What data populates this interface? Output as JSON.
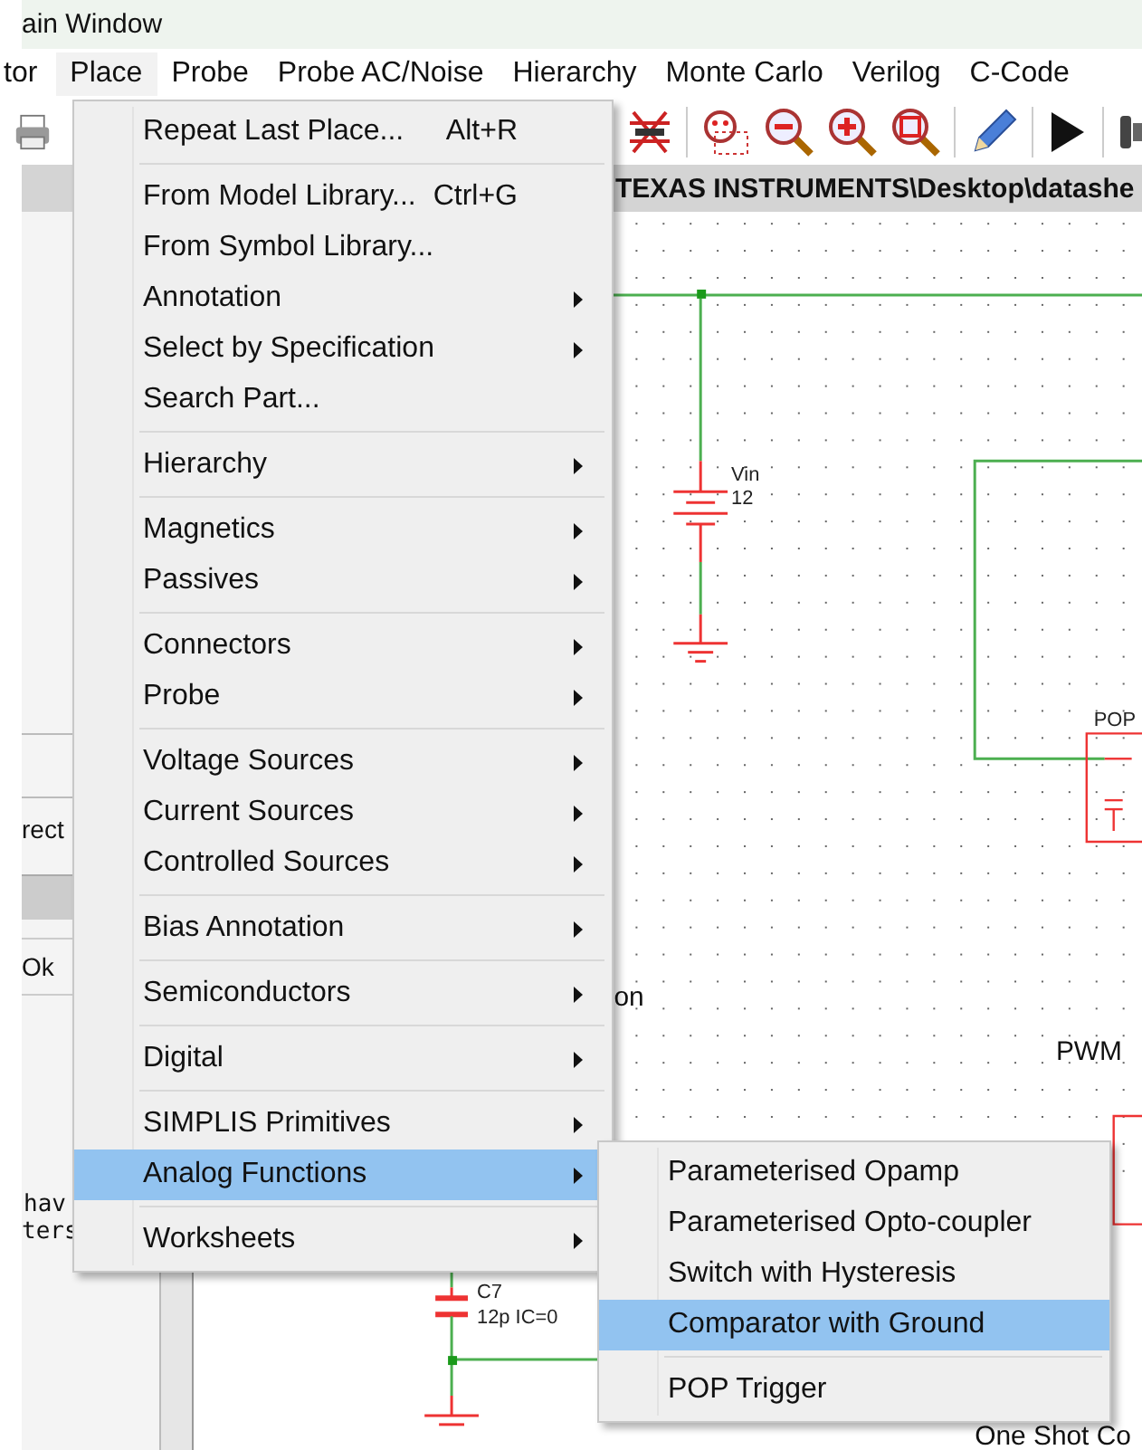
{
  "window": {
    "title": "ain Window"
  },
  "menubar": [
    {
      "label": "tor",
      "selected": false
    },
    {
      "label": "Place",
      "selected": true
    },
    {
      "label": "Probe",
      "selected": false
    },
    {
      "label": "Probe AC/Noise",
      "selected": false
    },
    {
      "label": "Hierarchy",
      "selected": false
    },
    {
      "label": "Monte Carlo",
      "selected": false
    },
    {
      "label": "Verilog",
      "selected": false
    },
    {
      "label": "C-Code",
      "selected": false
    }
  ],
  "path_bar": {
    "text": "TEXAS INSTRUMENTS\\Desktop\\datashe"
  },
  "side_panel": {
    "texts": [
      "rect",
      "Ok",
      "hav",
      "ters"
    ]
  },
  "schematic": {
    "vin_name": "Vin",
    "vin_value": "12",
    "pop_label": "POP",
    "partial_label": "on",
    "pwm_label": "PWM",
    "c7_name": "C7",
    "c7_value": "12p IC=0",
    "one_shot_label": "One Shot Co"
  },
  "place_menu": {
    "groups": [
      [
        {
          "label": "Repeat Last Place...",
          "shortcut": "Alt+R",
          "submenu": false,
          "selected": false
        }
      ],
      [
        {
          "label": "From Model Library...",
          "shortcut": "Ctrl+G",
          "submenu": false,
          "selected": false
        },
        {
          "label": "From Symbol Library...",
          "submenu": false,
          "selected": false
        },
        {
          "label": "Annotation",
          "submenu": true,
          "selected": false
        },
        {
          "label": "Select by Specification",
          "submenu": true,
          "selected": false
        },
        {
          "label": "Search Part...",
          "submenu": false,
          "selected": false
        }
      ],
      [
        {
          "label": "Hierarchy",
          "submenu": true,
          "selected": false
        }
      ],
      [
        {
          "label": "Magnetics",
          "submenu": true,
          "selected": false
        },
        {
          "label": "Passives",
          "submenu": true,
          "selected": false
        }
      ],
      [
        {
          "label": "Connectors",
          "submenu": true,
          "selected": false
        },
        {
          "label": "Probe",
          "submenu": true,
          "selected": false
        }
      ],
      [
        {
          "label": "Voltage Sources",
          "submenu": true,
          "selected": false
        },
        {
          "label": "Current Sources",
          "submenu": true,
          "selected": false
        },
        {
          "label": "Controlled Sources",
          "submenu": true,
          "selected": false
        }
      ],
      [
        {
          "label": "Bias Annotation",
          "submenu": true,
          "selected": false
        }
      ],
      [
        {
          "label": "Semiconductors",
          "submenu": true,
          "selected": false
        }
      ],
      [
        {
          "label": "Digital",
          "submenu": true,
          "selected": false
        }
      ],
      [
        {
          "label": "SIMPLIS Primitives",
          "submenu": true,
          "selected": false
        },
        {
          "label": "Analog Functions",
          "submenu": true,
          "selected": true
        }
      ],
      [
        {
          "label": "Worksheets",
          "submenu": true,
          "selected": false
        }
      ]
    ]
  },
  "submenu": {
    "groups": [
      [
        {
          "label": "Parameterised Opamp",
          "selected": false
        },
        {
          "label": "Parameterised Opto-coupler",
          "selected": false
        },
        {
          "label": "Switch with Hysteresis",
          "selected": false
        },
        {
          "label": "Comparator with Ground",
          "selected": true
        }
      ],
      [
        {
          "label": "POP Trigger",
          "selected": false
        }
      ]
    ]
  }
}
